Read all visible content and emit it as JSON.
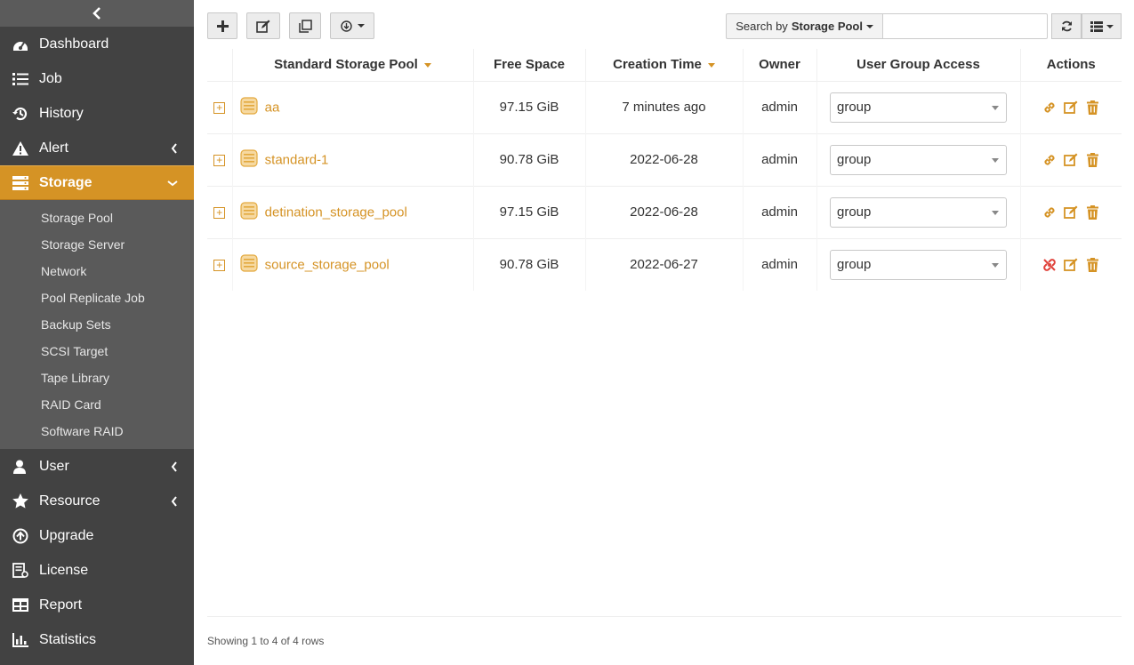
{
  "sidebar": {
    "items_top": [
      {
        "label": "Dashboard",
        "icon": "dashboard-icon"
      },
      {
        "label": "Job",
        "icon": "job-list-icon"
      },
      {
        "label": "History",
        "icon": "history-icon"
      },
      {
        "label": "Alert",
        "icon": "alert-icon"
      }
    ],
    "storage": {
      "label": "Storage",
      "icon": "storage-icon"
    },
    "submenu": [
      "Storage Pool",
      "Storage Server",
      "Network",
      "Pool Replicate Job",
      "Backup Sets",
      "SCSI Target",
      "Tape Library",
      "RAID Card",
      "Software RAID"
    ],
    "items_bottom": [
      {
        "label": "User",
        "icon": "user-icon"
      },
      {
        "label": "Resource",
        "icon": "star-icon"
      },
      {
        "label": "Upgrade",
        "icon": "upgrade-icon"
      },
      {
        "label": "License",
        "icon": "license-icon"
      },
      {
        "label": "Report",
        "icon": "report-icon"
      },
      {
        "label": "Statistics",
        "icon": "statistics-icon"
      }
    ]
  },
  "search": {
    "by_prefix": "Search by",
    "by_field": "Storage Pool",
    "value": ""
  },
  "columns": {
    "pool": "Standard Storage Pool",
    "free": "Free Space",
    "created": "Creation Time",
    "owner": "Owner",
    "group_access": "User Group Access",
    "actions": "Actions"
  },
  "rows": [
    {
      "name": "aa",
      "free": "97.15 GiB",
      "created": "7 minutes ago",
      "owner": "admin",
      "group": "group",
      "link_status": "linked"
    },
    {
      "name": "standard-1",
      "free": "90.78 GiB",
      "created": "2022-06-28",
      "owner": "admin",
      "group": "group",
      "link_status": "linked"
    },
    {
      "name": "detination_storage_pool",
      "free": "97.15 GiB",
      "created": "2022-06-28",
      "owner": "admin",
      "group": "group",
      "link_status": "linked"
    },
    {
      "name": "source_storage_pool",
      "free": "90.78 GiB",
      "created": "2022-06-27",
      "owner": "admin",
      "group": "group",
      "link_status": "unlinked"
    }
  ],
  "footer": {
    "text": "Showing 1 to 4 of 4 rows"
  },
  "colors": {
    "accent": "#d59325",
    "sidebar_bg": "#424242",
    "submenu_bg": "#5a5a5a",
    "danger": "#e0413a"
  }
}
